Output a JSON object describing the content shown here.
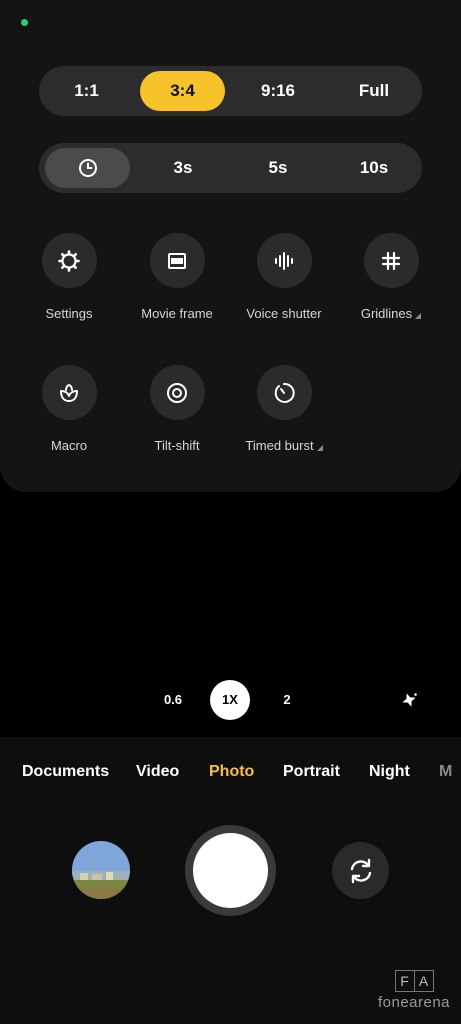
{
  "aspect_ratio": {
    "options": [
      "1:1",
      "3:4",
      "9:16",
      "Full"
    ],
    "selected": "3:4",
    "selected_color": "#f7c32a"
  },
  "timer": {
    "options": [
      "3s",
      "5s",
      "10s"
    ],
    "selected_icon": "clock-icon"
  },
  "tools": [
    {
      "label": "Settings",
      "icon": "gear-icon"
    },
    {
      "label": "Movie frame",
      "icon": "movie-frame-icon"
    },
    {
      "label": "Voice shutter",
      "icon": "soundwave-icon"
    },
    {
      "label": "Gridlines",
      "icon": "grid-icon"
    },
    {
      "label": "Macro",
      "icon": "macro-flower-icon"
    },
    {
      "label": "Tilt-shift",
      "icon": "tilt-shift-icon"
    },
    {
      "label": "Timed burst",
      "icon": "timed-burst-icon"
    }
  ],
  "zoom": {
    "options": [
      "0.6",
      "1X",
      "2"
    ],
    "selected": "1X"
  },
  "modes": {
    "items": [
      "Documents",
      "Video",
      "Photo",
      "Portrait",
      "Night",
      "M"
    ],
    "selected": "Photo",
    "active_color": "#f6be4a"
  },
  "watermark": {
    "letters": [
      "F",
      "A"
    ],
    "text": "fonearena"
  }
}
